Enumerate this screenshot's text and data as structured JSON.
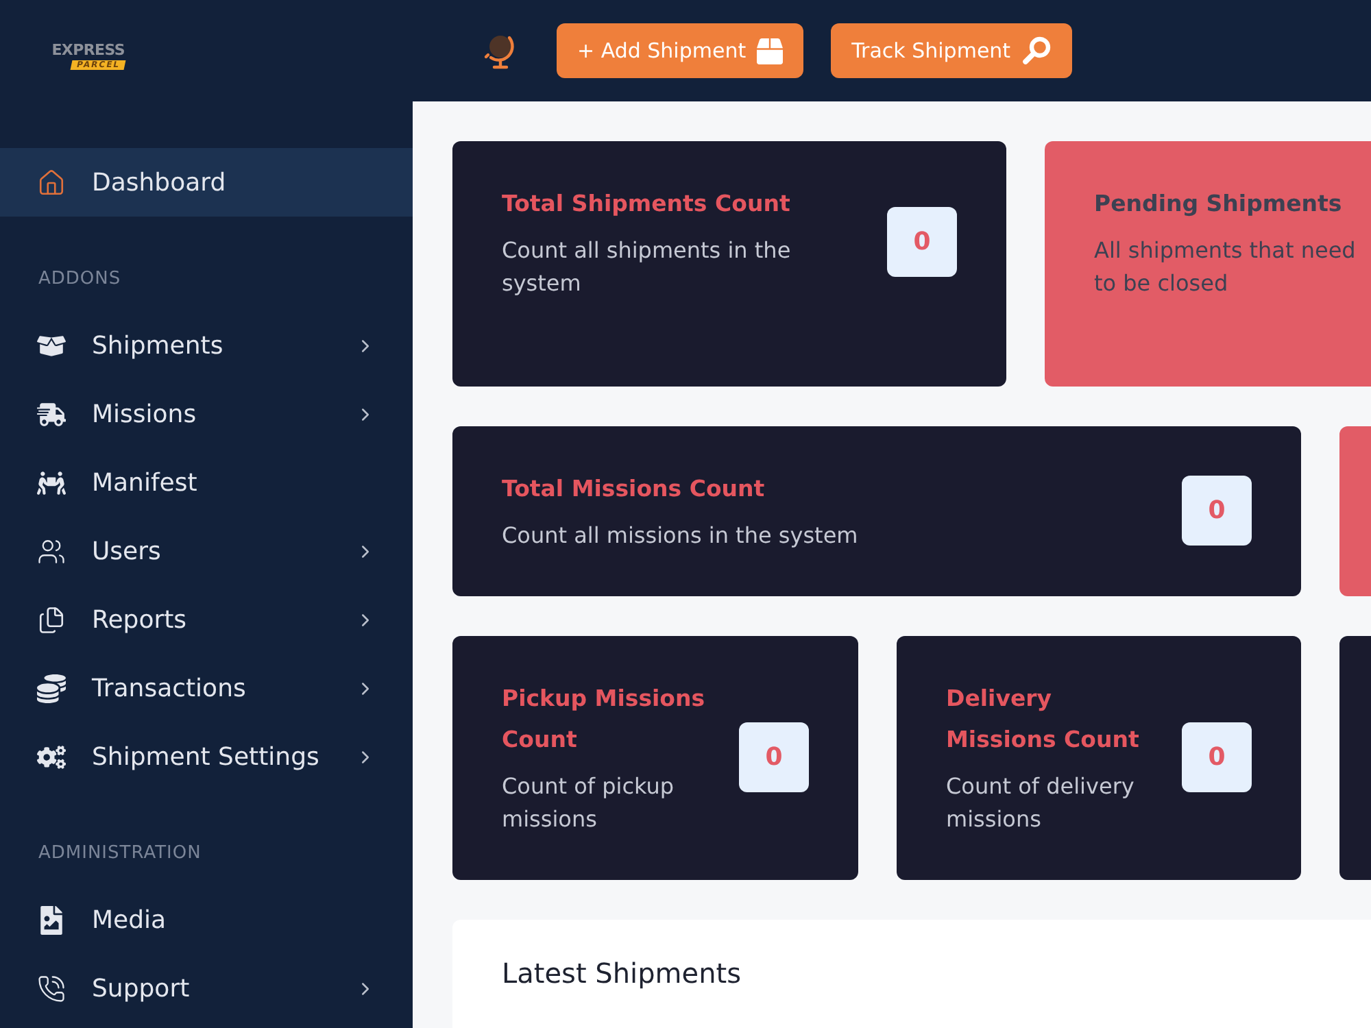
{
  "sidebar": {
    "logo": {
      "wordmark": "EXPRESS",
      "tagline": "PARCEL"
    },
    "sections": [
      {
        "items": [
          {
            "label": "Dashboard",
            "selected": true,
            "has_submenu": false
          }
        ]
      },
      {
        "heading": "ADDONS",
        "items": [
          {
            "label": "Shipments",
            "selected": false,
            "has_submenu": true
          },
          {
            "label": "Missions",
            "selected": false,
            "has_submenu": true
          },
          {
            "label": "Manifest",
            "selected": false,
            "has_submenu": false
          },
          {
            "label": "Users",
            "selected": false,
            "has_submenu": true
          },
          {
            "label": "Reports",
            "selected": false,
            "has_submenu": true
          },
          {
            "label": "Transactions",
            "selected": false,
            "has_submenu": true
          },
          {
            "label": "Shipment Settings",
            "selected": false,
            "has_submenu": true
          }
        ]
      },
      {
        "heading": "ADMINISTRATION",
        "items": [
          {
            "label": "Media",
            "selected": false,
            "has_submenu": false
          },
          {
            "label": "Support",
            "selected": false,
            "has_submenu": true
          }
        ]
      }
    ]
  },
  "topbar": {
    "buttons": [
      {
        "label": "+ Add Shipment"
      },
      {
        "label": "Track Shipment"
      }
    ]
  },
  "stat_rows": [
    [
      {
        "kind": "standard",
        "title": "Total Shipments Count",
        "description": "Count all shipments in the system",
        "count": "0"
      },
      {
        "kind": "alert",
        "title": "Pending Shipments",
        "description": "All shipments that need to be closed"
      }
    ],
    [
      {
        "kind": "standard",
        "title": "Total Missions Count",
        "description": "Count all missions in the system",
        "count": "0"
      },
      {
        "kind": "alert"
      }
    ],
    [
      {
        "kind": "standard",
        "title": "Pickup Missions Count",
        "description": "Count of pickup missions",
        "count": "0"
      },
      {
        "kind": "standard",
        "title": "Delivery Missions Count",
        "description": "Count of delivery missions",
        "count": "0"
      },
      {
        "kind": "standard"
      }
    ]
  ],
  "latest_shipments": {
    "title": "Latest Shipments"
  }
}
